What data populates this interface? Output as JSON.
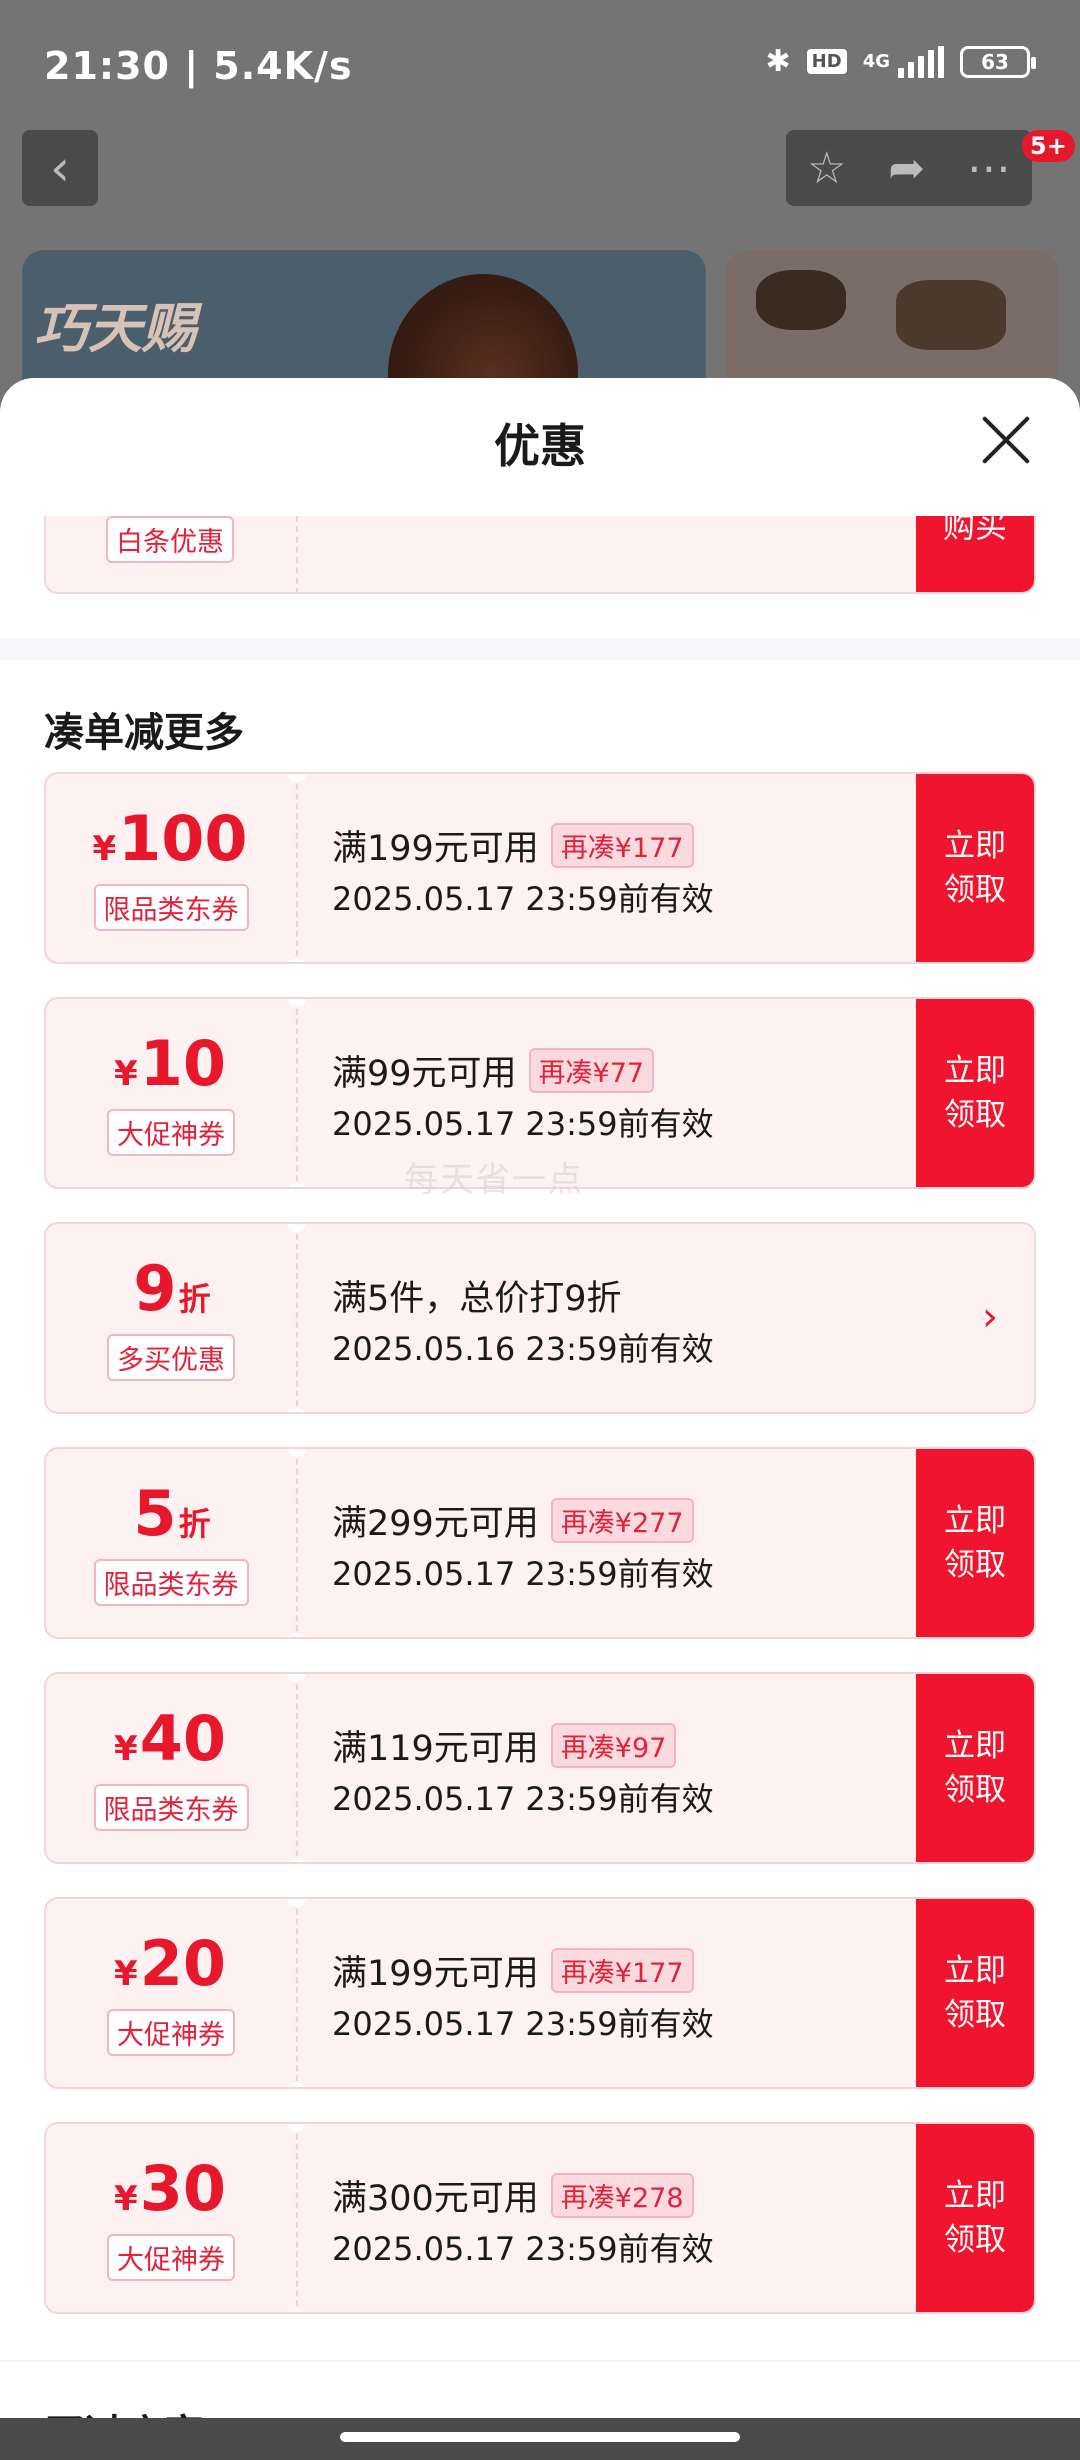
{
  "status": {
    "time": "21:30 | 5.4K/s",
    "hd": "HD",
    "network": "4G",
    "battery": "63"
  },
  "header": {
    "notification_count": "5+"
  },
  "banner": {
    "brand_text": "巧天赐"
  },
  "sheet": {
    "title": "优惠"
  },
  "partial_coupon": {
    "badge": "白条优惠",
    "action": "购买"
  },
  "section": {
    "title": "凑单减更多"
  },
  "coupons": [
    {
      "currency": "¥",
      "amount": "100",
      "unit": "",
      "badge": "限品类东券",
      "condition": "满199元可用",
      "need": "再凑¥177",
      "validity": "2025.05.17 23:59前有效",
      "action_line1": "立即",
      "action_line2": "领取"
    },
    {
      "currency": "¥",
      "amount": "10",
      "unit": "",
      "badge": "大促神券",
      "condition": "满99元可用",
      "need": "再凑¥77",
      "validity": "2025.05.17 23:59前有效",
      "action_line1": "立即",
      "action_line2": "领取"
    },
    {
      "currency": "",
      "amount": "9",
      "unit": "折",
      "badge": "多买优惠",
      "condition": "满5件，总价打9折",
      "need": "",
      "validity": "2025.05.16 23:59前有效",
      "action_line1": "",
      "action_line2": ""
    },
    {
      "currency": "",
      "amount": "5",
      "unit": "折",
      "badge": "限品类东券",
      "condition": "满299元可用",
      "need": "再凑¥277",
      "validity": "2025.05.17 23:59前有效",
      "action_line1": "立即",
      "action_line2": "领取"
    },
    {
      "currency": "¥",
      "amount": "40",
      "unit": "",
      "badge": "限品类东券",
      "condition": "满119元可用",
      "need": "再凑¥97",
      "validity": "2025.05.17 23:59前有效",
      "action_line1": "立即",
      "action_line2": "领取"
    },
    {
      "currency": "¥",
      "amount": "20",
      "unit": "",
      "badge": "大促神券",
      "condition": "满199元可用",
      "need": "再凑¥177",
      "validity": "2025.05.17 23:59前有效",
      "action_line1": "立即",
      "action_line2": "领取"
    },
    {
      "currency": "¥",
      "amount": "30",
      "unit": "",
      "badge": "大促神券",
      "condition": "满300元可用",
      "need": "再凑¥278",
      "validity": "2025.05.17 23:59前有效",
      "action_line1": "立即",
      "action_line2": "领取"
    }
  ],
  "watermark": "每天省一点",
  "next_section": {
    "title": "买过店家"
  }
}
